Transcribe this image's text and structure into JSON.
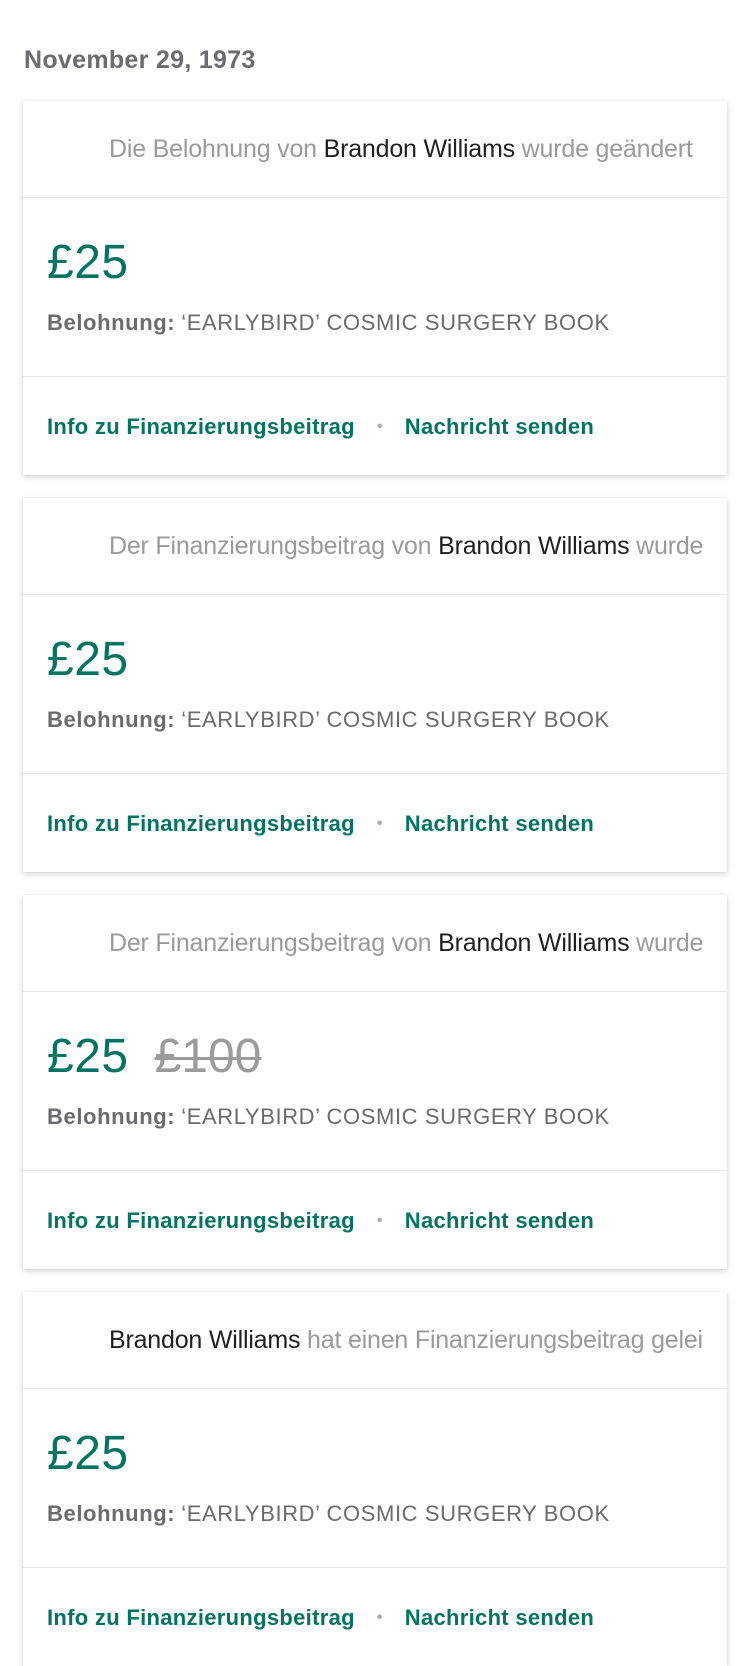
{
  "date_header": "November 29, 1973",
  "cards": [
    {
      "head_prefix": "Die Belohnung von ",
      "head_name": "Brandon Williams",
      "head_suffix": " wurde geändert",
      "amount": "£25",
      "old_amount": "",
      "reward_label": "Belohnung:",
      "reward_value": "‘EARLYBIRD’ COSMIC SURGERY BOOK",
      "link_info": "Info zu Finanzierungsbeitrag",
      "separator": "•",
      "link_message": "Nachricht senden"
    },
    {
      "head_prefix": "Der Finanzierungsbeitrag von ",
      "head_name": "Brandon Williams",
      "head_suffix": " wurde geändert",
      "amount": "£25",
      "old_amount": "",
      "reward_label": "Belohnung:",
      "reward_value": "‘EARLYBIRD’ COSMIC SURGERY BOOK",
      "link_info": "Info zu Finanzierungsbeitrag",
      "separator": "•",
      "link_message": "Nachricht senden"
    },
    {
      "head_prefix": "Der Finanzierungsbeitrag von ",
      "head_name": "Brandon Williams",
      "head_suffix": " wurde geändert",
      "amount": "£25",
      "old_amount": "£100",
      "reward_label": "Belohnung:",
      "reward_value": "‘EARLYBIRD’ COSMIC SURGERY BOOK",
      "link_info": "Info zu Finanzierungsbeitrag",
      "separator": "•",
      "link_message": "Nachricht senden"
    },
    {
      "head_prefix": "",
      "head_name": "Brandon Williams",
      "head_suffix": " hat einen Finanzierungsbeitrag geleistet",
      "amount": "£25",
      "old_amount": "",
      "reward_label": "Belohnung:",
      "reward_value": "‘EARLYBIRD’ COSMIC SURGERY BOOK",
      "link_info": "Info zu Finanzierungsbeitrag",
      "separator": "•",
      "link_message": "Nachricht senden"
    }
  ],
  "colors": {
    "accent": "#037362",
    "muted_text": "#9a9a9a",
    "name_text": "#1f1f1f"
  }
}
